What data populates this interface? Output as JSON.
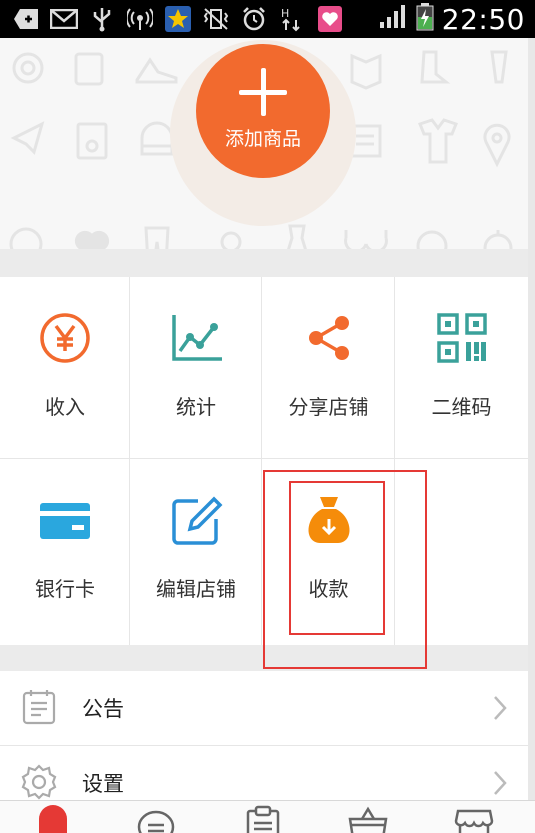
{
  "status_bar": {
    "time": "22:50",
    "icons": [
      "back-arrow-icon",
      "mail-icon",
      "usb-icon",
      "wireless-icon",
      "star-app-icon",
      "vibrate-icon",
      "alarm-icon",
      "data-arrows-icon",
      "notification-heart-icon",
      "signal-icon",
      "battery-charging-icon"
    ]
  },
  "hero": {
    "add_button_label": "添加商品"
  },
  "grid": {
    "items": [
      {
        "label": "收入",
        "icon": "yuan-icon",
        "color": "#f26a2e"
      },
      {
        "label": "统计",
        "icon": "line-chart-icon",
        "color": "#3aa19a"
      },
      {
        "label": "分享店铺",
        "icon": "share-icon",
        "color": "#f26a2e"
      },
      {
        "label": "二维码",
        "icon": "qr-code-icon",
        "color": "#3aa19a"
      },
      {
        "label": "银行卡",
        "icon": "bank-card-icon",
        "color": "#2aa7de"
      },
      {
        "label": "编辑店铺",
        "icon": "edit-icon",
        "color": "#2a8fd6"
      },
      {
        "label": "收款",
        "icon": "money-bag-icon",
        "color": "#f58c0a"
      }
    ]
  },
  "list": {
    "items": [
      {
        "label": "公告",
        "icon": "notice-icon"
      },
      {
        "label": "设置",
        "icon": "settings-icon"
      }
    ]
  },
  "tabbar": {
    "items": [
      "home-tab-icon",
      "message-tab-icon",
      "orders-tab-icon",
      "basket-tab-icon",
      "shop-tab-icon"
    ],
    "active_color": "#e53935"
  }
}
